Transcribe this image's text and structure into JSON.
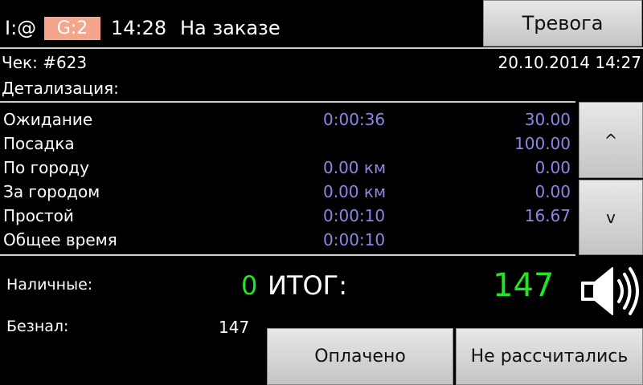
{
  "status": {
    "i_indicator": "I:@",
    "g_badge": "G:2",
    "time": "14:28",
    "state": "На заказе"
  },
  "alarm_button": "Тревога",
  "check": {
    "number_label": "Чек: #623",
    "datetime": "20.10.2014 14:27",
    "details_label": "Детализация:"
  },
  "details": [
    {
      "label": "Ожидание",
      "value": "0:00:36",
      "amount": "30.00"
    },
    {
      "label": "Посадка",
      "value": "",
      "amount": "100.00"
    },
    {
      "label": "По городу",
      "value": "0.00 км",
      "amount": "0.00"
    },
    {
      "label": "За городом",
      "value": "0.00 км",
      "amount": "0.00"
    },
    {
      "label": "Простой",
      "value": "0:00:10",
      "amount": "16.67"
    },
    {
      "label": "Общее время",
      "value": "0:00:10",
      "amount": ""
    }
  ],
  "scroll": {
    "up": "^",
    "down": "v"
  },
  "payment": {
    "cash_label": "Наличные:",
    "cash_value": "0",
    "total_label": "ИТОГ:",
    "total_value": "147",
    "cashless_label": "Безнал:",
    "cashless_value": "147"
  },
  "buttons": {
    "paid": "Оплачено",
    "not_settled": "Не рассчитались"
  },
  "colors": {
    "value_blue": "#8b86e8",
    "total_green": "#22e622",
    "badge": "#f4a58c"
  },
  "icons": {
    "sound": "speaker-icon"
  }
}
